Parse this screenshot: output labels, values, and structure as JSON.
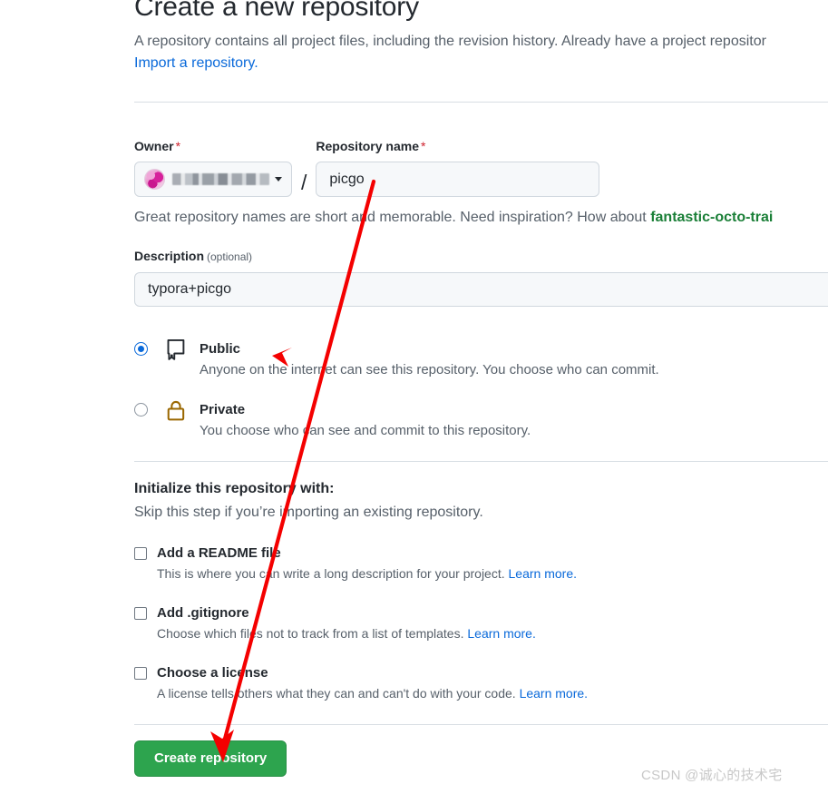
{
  "header": {
    "title": "Create a new repository",
    "subtitle_text": "A repository contains all project files, including the revision history. Already have a project repositor",
    "import_link": "Import a repository."
  },
  "owner": {
    "label": "Owner",
    "required_mark": "*",
    "name_redacted": true,
    "avatar_icon": "user-avatar-icon",
    "caret_icon": "chevron-down-icon"
  },
  "repo_name": {
    "label": "Repository name",
    "required_mark": "*",
    "value": "picgo",
    "placeholder": "",
    "valid_icon": "check-icon",
    "valid_color": "#4caf50"
  },
  "separator": "/",
  "hint": {
    "text_before": "Great repository names are short and memorable. Need inspiration? How about ",
    "suggestion": "fantastic-octo-trai"
  },
  "description": {
    "label": "Description",
    "optional": "(optional)",
    "value": "typora+picgo",
    "placeholder": ""
  },
  "visibility": {
    "options": [
      {
        "id": "public",
        "title": "Public",
        "desc": "Anyone on the internet can see this repository. You choose who can commit.",
        "selected": true,
        "icon": "book-icon",
        "icon_color": "#24292f"
      },
      {
        "id": "private",
        "title": "Private",
        "desc": "You choose who can see and commit to this repository.",
        "selected": false,
        "icon": "lock-icon",
        "icon_color": "#9a6700"
      }
    ]
  },
  "initialize": {
    "title": "Initialize this repository with:",
    "subtitle": "Skip this step if you’re importing an existing repository.",
    "items": [
      {
        "id": "readme",
        "title": "Add a README file",
        "desc": "This is where you can write a long description for your project. ",
        "link": "Learn more.",
        "checked": false
      },
      {
        "id": "gitignore",
        "title": "Add .gitignore",
        "desc": "Choose which files not to track from a list of templates. ",
        "link": "Learn more.",
        "checked": false
      },
      {
        "id": "license",
        "title": "Choose a license",
        "desc": "A license tells others what they can and can't do with your code. ",
        "link": "Learn more.",
        "checked": false
      }
    ]
  },
  "submit": {
    "label": "Create repository",
    "color": "#2da44e"
  },
  "annotation": {
    "arrow_color": "#f40000",
    "description": "red annotation arrow from repository name field down to create repository button"
  },
  "watermark": {
    "text": "CSDN @诚心的技术宅"
  }
}
